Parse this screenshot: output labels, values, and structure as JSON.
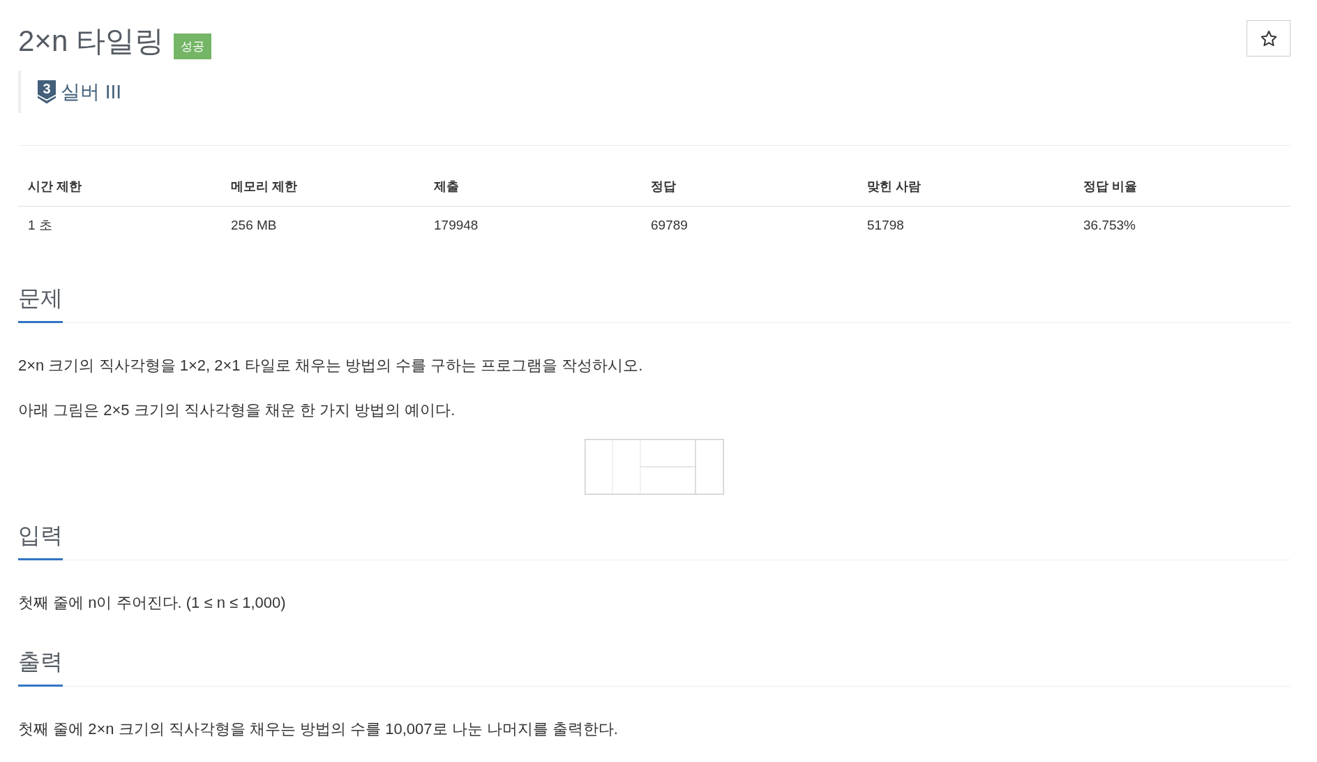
{
  "problem": {
    "title": "2×n 타일링",
    "result_badge": "성공",
    "starred": false,
    "tier": {
      "number": "3",
      "label": "실버 III"
    }
  },
  "stats_table": {
    "columns": [
      "시간 제한",
      "메모리 제한",
      "제출",
      "정답",
      "맞힌 사람",
      "정답 비율"
    ],
    "rows": [
      [
        "1 초",
        "256 MB",
        "179948",
        "69789",
        "51798",
        "36.753%"
      ]
    ]
  },
  "sections": [
    {
      "heading": "문제",
      "content": [
        {
          "kind": "paragraph",
          "text": "2×n 크기의 직사각형을 1×2, 2×1 타일로 채우는 방법의 수를 구하는 프로그램을 작성하시오."
        },
        {
          "kind": "paragraph",
          "text": "아래 그림은 2×5 크기의 직사각형을 채운 한 가지 방법의 예이다."
        },
        {
          "kind": "tiling_figure"
        }
      ]
    },
    {
      "heading": "입력",
      "content": [
        {
          "kind": "paragraph",
          "text": "첫째 줄에 n이 주어진다. (1 ≤ n ≤ 1,000)"
        }
      ]
    },
    {
      "heading": "출력",
      "content": [
        {
          "kind": "paragraph",
          "text": "첫째 줄에 2×n 크기의 직사각형을 채우는 방법의 수를 10,007로 나눈 나머지를 출력한다."
        }
      ]
    }
  ]
}
